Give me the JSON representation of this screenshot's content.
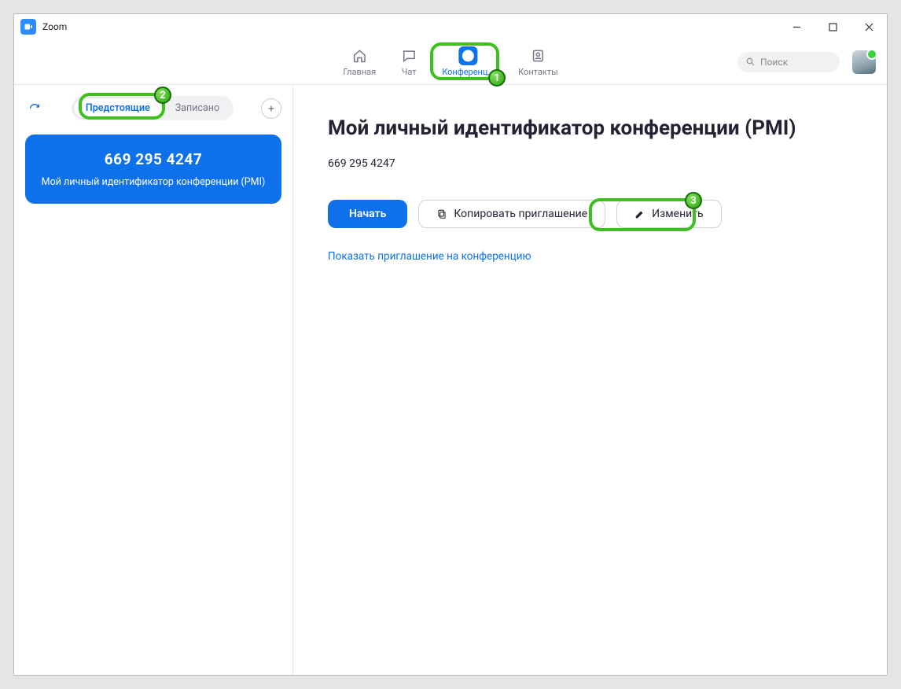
{
  "window": {
    "title": "Zoom"
  },
  "nav": {
    "home": "Главная",
    "chat": "Чат",
    "meetings": "Конференц...",
    "contacts": "Контакты"
  },
  "search": {
    "placeholder": "Поиск"
  },
  "sidebar": {
    "upcoming": "Предстоящие",
    "recorded": "Записано",
    "card": {
      "pmi": "669 295 4247",
      "sub": "Мой личный идентификатор конференции (PMI)"
    }
  },
  "main": {
    "title": "Мой личный идентификатор конференции (PMI)",
    "pmi": "669 295 4247",
    "start": "Начать",
    "copy": "Копировать приглашение",
    "edit": "Изменить",
    "show_invite": "Показать приглашение на конференцию"
  },
  "annotations": {
    "a1": "1",
    "a2": "2",
    "a3": "3"
  }
}
